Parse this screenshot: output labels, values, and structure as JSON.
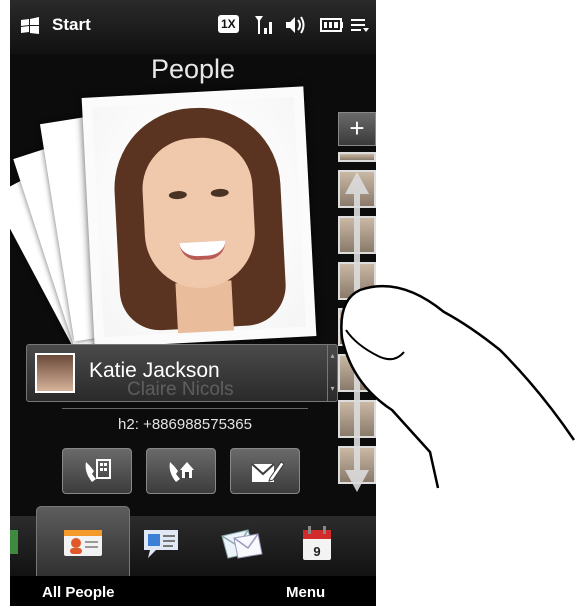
{
  "status_bar": {
    "start_label": "Start",
    "network_badge": "1X",
    "icons": [
      "windows-logo-icon",
      "signal-icon",
      "volume-icon",
      "battery-icon",
      "menu-icon"
    ]
  },
  "header": {
    "title": "People"
  },
  "contact": {
    "name": "Katie Jackson",
    "next_name": "Claire Nicols",
    "phone": "h2: +886988575365"
  },
  "actions": [
    {
      "icon": "call-work-icon"
    },
    {
      "icon": "call-home-icon"
    },
    {
      "icon": "compose-message-icon"
    }
  ],
  "thumbnail_strip": {
    "add_label": "+"
  },
  "tabs": [
    {
      "icon": "partial-tab-icon"
    },
    {
      "icon": "people-card-icon",
      "active": true
    },
    {
      "icon": "messaging-icon"
    },
    {
      "icon": "email-icon"
    },
    {
      "icon": "calendar-icon",
      "text": "9"
    }
  ],
  "softkeys": {
    "left": "All People",
    "right": "Menu"
  },
  "colors": {
    "background": "#0c0c0c",
    "text": "#ffffff",
    "accent_red": "#d22b2b"
  }
}
